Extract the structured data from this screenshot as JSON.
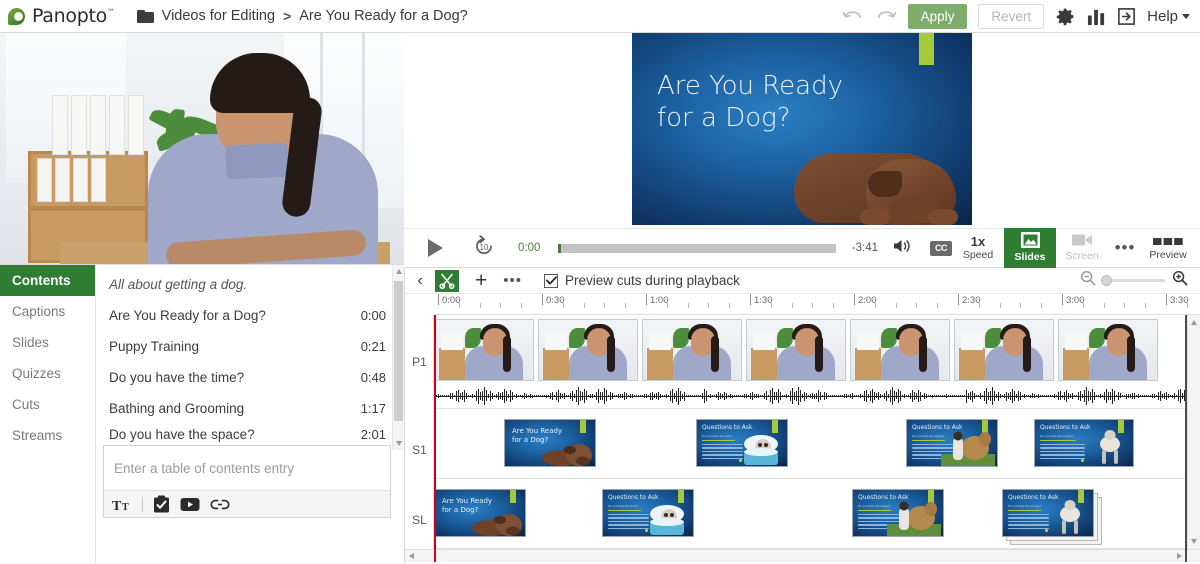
{
  "app": {
    "brand": "Panopto",
    "trademark": "™"
  },
  "breadcrumb": {
    "folder": "Videos for Editing",
    "separator": ">",
    "current": "Are You Ready for a Dog?"
  },
  "toolbar": {
    "undo": "undo-arrow",
    "redo": "redo-arrow",
    "apply_label": "Apply",
    "revert_label": "Revert",
    "settings": "gear-icon",
    "stats": "bar-chart-icon",
    "exit": "exit-icon",
    "help_label": "Help",
    "apply_color": "#7fab6b",
    "revert_color": "#b5b5b5"
  },
  "player": {
    "play": "play-icon",
    "rewind_label": "10",
    "current_time": "0:00",
    "remaining_time": "-3:41",
    "volume": "volume-icon",
    "captions_label": "CC",
    "speed_value": "1x",
    "speed_label": "Speed",
    "slides_label": "Slides",
    "screen_label": "Screen",
    "more": "•••",
    "preview_label": "Preview",
    "active_view": "Slides",
    "accent_color": "#2e7d32",
    "time_color": "#4b7c3f"
  },
  "slide_preview": {
    "title_line1": "Are You Ready",
    "title_line2": "for a Dog?",
    "background_color": "#1b5f9e",
    "accent_color": "#a4c93a"
  },
  "editor_tabs": {
    "items": [
      {
        "label": "Contents",
        "active": true
      },
      {
        "label": "Captions",
        "active": false
      },
      {
        "label": "Slides",
        "active": false
      },
      {
        "label": "Quizzes",
        "active": false
      },
      {
        "label": "Cuts",
        "active": false
      },
      {
        "label": "Streams",
        "active": false
      }
    ]
  },
  "contents": {
    "description": "All about getting a dog.",
    "entries": [
      {
        "title": "Are You Ready for a Dog?",
        "time": "0:00"
      },
      {
        "title": "Puppy Training",
        "time": "0:21"
      },
      {
        "title": "Do you have the time?",
        "time": "0:48"
      },
      {
        "title": "Bathing and Grooming",
        "time": "1:17"
      },
      {
        "title": "Do you have the space?",
        "time": "2:01"
      }
    ],
    "entry_placeholder": "Enter a table of contents entry",
    "entry_value": "",
    "tools": [
      {
        "name": "text-format-icon",
        "glyph": "Tт"
      },
      {
        "name": "quiz-icon",
        "glyph": "clipboard"
      },
      {
        "name": "video-icon",
        "glyph": "youtube"
      },
      {
        "name": "link-icon",
        "glyph": "chain"
      }
    ]
  },
  "timeline_toolbar": {
    "back": "chevron-left-icon",
    "cut_tool": "scissors-icon",
    "add": "+",
    "more": "•••",
    "preview_cuts_label": "Preview cuts during playback",
    "preview_cuts_checked": true,
    "zoom_out": "zoom-out-icon",
    "zoom_in": "zoom-in-icon",
    "zoom_value": 0,
    "cut_tool_active": true
  },
  "timeline": {
    "ruler_labels": [
      "0:00",
      "0:30",
      "1:00",
      "1:30",
      "2:00",
      "2:30",
      "3:00",
      "3:30"
    ],
    "major_interval_seconds": 30,
    "minor_ticks_per_major": 5,
    "duration_label": "3:41",
    "playhead_time": "0:00",
    "tracks": [
      {
        "label": "P1",
        "type": "video"
      },
      {
        "label": "S1",
        "type": "slides"
      },
      {
        "label": "SL",
        "type": "slides-stream"
      }
    ],
    "s1_slides": [
      {
        "title": "Are You Ready for a Dog?",
        "subtitle": "",
        "image": "puppy"
      },
      {
        "title": "Questions to Ask",
        "subtitle": "Do you have the time?",
        "image": "bath-dog"
      },
      {
        "title": "Questions to Ask",
        "subtitle": "Do you have the space?",
        "image": "big-dog"
      },
      {
        "title": "Questions to Ask",
        "subtitle": "Do you have the money?",
        "image": "jumping-dog"
      }
    ],
    "sl_slides": [
      {
        "title": "Are You Ready for a Dog?",
        "subtitle": "",
        "image": "puppy",
        "stacked": false
      },
      {
        "title": "Questions to Ask",
        "subtitle": "Do you have the time?",
        "image": "bath-dog",
        "stacked": false
      },
      {
        "title": "Questions to Ask",
        "subtitle": "Do you have the space?",
        "image": "big-dog",
        "stacked": false
      },
      {
        "title": "Questions to Ask",
        "subtitle": "Do you have the money?",
        "image": "jumping-dog",
        "stacked": true
      }
    ],
    "playhead_color": "#d0021b"
  }
}
